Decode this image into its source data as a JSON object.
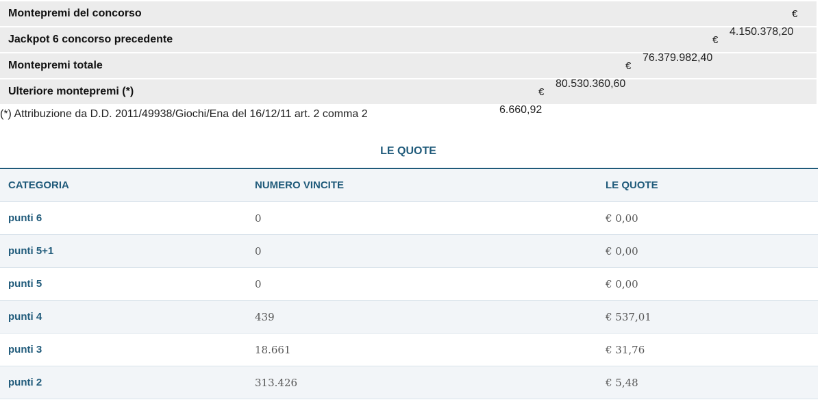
{
  "montepremi": {
    "rows": [
      {
        "label": "Montepremi del concorso",
        "currency": "€"
      },
      {
        "label": "Jackpot 6 concorso precedente",
        "currency": "€",
        "amount": "4.150.378,20"
      },
      {
        "label": "Montepremi totale",
        "currency": "€",
        "amount": "76.379.982,40"
      },
      {
        "label": "Ulteriore montepremi (*)",
        "currency": "€",
        "amount": "80.530.360,60"
      }
    ],
    "extra_amount": "6.660,92",
    "note": "(*) Attribuzione da D.D. 2011/49938/Giochi/Ena del 16/12/11 art. 2 comma 2"
  },
  "quote": {
    "title": "LE QUOTE",
    "headers": [
      "CATEGORIA",
      "NUMERO VINCITE",
      "LE QUOTE"
    ],
    "rows": [
      {
        "categoria": "punti 6",
        "vincite": "0",
        "quota": "€ 0,00"
      },
      {
        "categoria": "punti 5+1",
        "vincite": "0",
        "quota": "€ 0,00"
      },
      {
        "categoria": "punti 5",
        "vincite": "0",
        "quota": "€ 0,00"
      },
      {
        "categoria": "punti 4",
        "vincite": "439",
        "quota": "€ 537,01"
      },
      {
        "categoria": "punti 3",
        "vincite": "18.661",
        "quota": "€ 31,76"
      },
      {
        "categoria": "punti 2",
        "vincite": "313.426",
        "quota": "€ 5,48"
      }
    ]
  },
  "colors": {
    "accent": "#1f5a7a",
    "row_bg": "#ececec",
    "table_stripe": "#f2f5f8"
  }
}
